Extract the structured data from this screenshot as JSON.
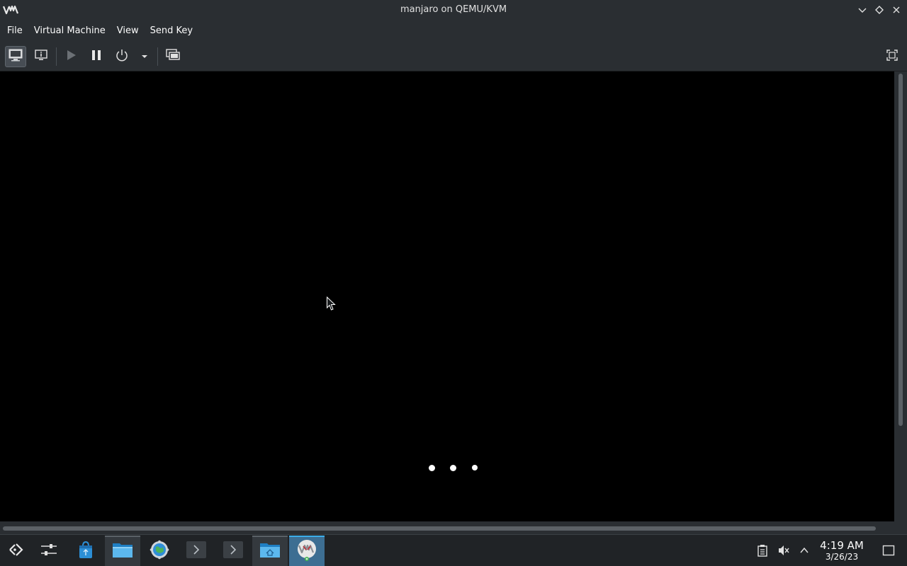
{
  "window": {
    "title": "manjaro on QEMU/KVM",
    "app_icon": "virt-manager-icon",
    "controls": [
      "minimize-icon",
      "maximize-icon",
      "close-icon"
    ]
  },
  "menubar": {
    "items": [
      "File",
      "Virtual Machine",
      "View",
      "Send Key"
    ]
  },
  "toolbar": {
    "buttons": [
      {
        "icon": "monitor-console-icon",
        "tooltip": "Show the graphical console",
        "state": "active"
      },
      {
        "icon": "info-details-icon",
        "tooltip": "Show virtual hardware details"
      },
      {
        "icon": "play-run-icon",
        "tooltip": "Run",
        "state": "disabled"
      },
      {
        "icon": "pause-icon",
        "tooltip": "Pause"
      },
      {
        "icon": "power-shutdown-icon",
        "tooltip": "Shut down"
      },
      {
        "icon": "dropdown-arrow-icon"
      },
      {
        "icon": "snapshots-icon",
        "tooltip": "Manage snapshots"
      },
      {
        "icon": "fullscreen-icon",
        "tooltip": "Fullscreen"
      }
    ]
  },
  "console": {
    "boot_indicator": "three-dots-loading"
  },
  "taskbar": {
    "apps": [
      {
        "icon": "application-launcher-icon"
      },
      {
        "icon": "system-settings-sliders-icon"
      },
      {
        "icon": "software-store-bag-icon"
      },
      {
        "icon": "file-manager-folder-icon",
        "state": "open"
      },
      {
        "icon": "browser-globe-gear-icon"
      },
      {
        "icon": "terminal-prompt-icon"
      },
      {
        "icon": "terminal-prompt-icon"
      },
      {
        "icon": "home-folder-icon",
        "state": "open"
      },
      {
        "icon": "virt-manager-icon",
        "state": "active"
      }
    ],
    "tray": [
      "clipboard-icon",
      "volume-muted-icon",
      "tray-expand-chevron-icon"
    ],
    "clock": {
      "time": "4:19 AM",
      "date": "3/26/23"
    },
    "show_desktop": "show-desktop-icon"
  },
  "colors": {
    "chrome": "#2a2e32",
    "panel": "#202326",
    "accent": "#3daee9",
    "console": "#000000"
  }
}
